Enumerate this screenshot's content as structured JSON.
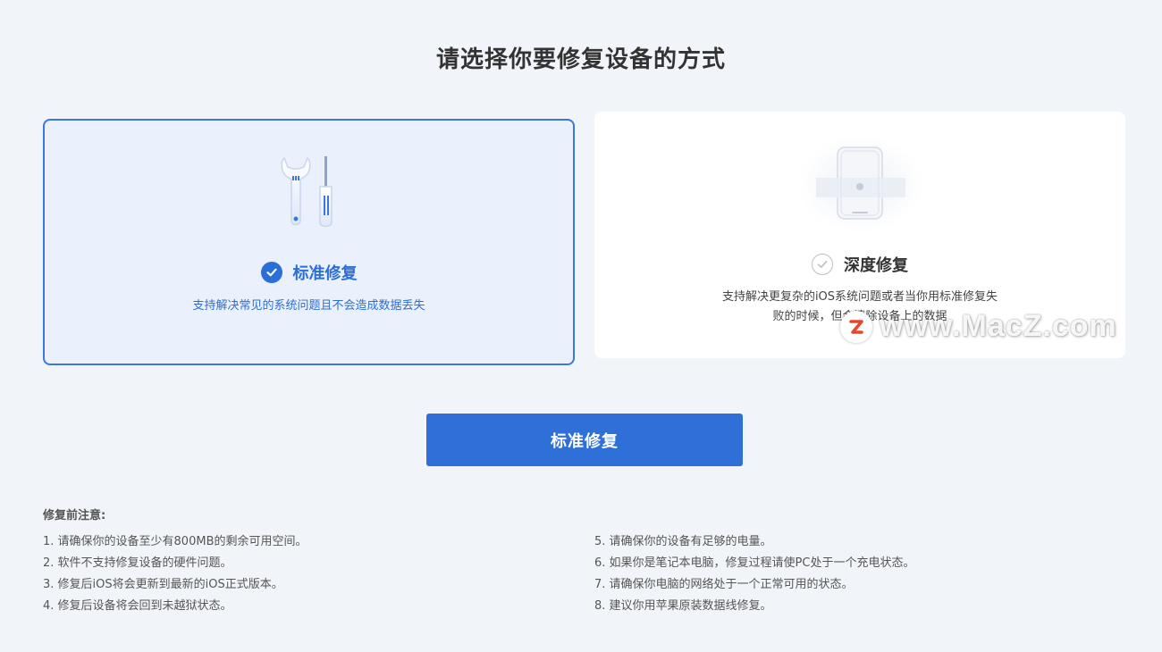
{
  "page": {
    "title": "请选择你要修复设备的方式"
  },
  "cards": {
    "standard": {
      "label": "标准修复",
      "description": "支持解决常见的系统问题且不会造成数据丢失",
      "selected": true,
      "icon": "wrench-screwdriver-icon"
    },
    "deep": {
      "label": "深度修复",
      "description_line1": "支持解决更复杂的iOS系统问题或者当你用标准修复失",
      "description_line2": "败的时候，但会清除设备上的数据",
      "selected": false,
      "icon": "device-repair-icon"
    }
  },
  "primary_button": {
    "label": "标准修复"
  },
  "notes": {
    "title": "修复前注意:",
    "left": [
      "1.  请确保你的设备至少有800MB的剩余可用空间。",
      "2.  软件不支持修复设备的硬件问题。",
      "3.  修复后iOS将会更新到最新的iOS正式版本。",
      "4.  修复后设备将会回到未越狱状态。"
    ],
    "right": [
      "5.  请确保你的设备有足够的电量。",
      "6.  如果你是笔记本电脑，修复过程请使PC处于一个充电状态。",
      "7.  请确保你电脑的网络处于一个正常可用的状态。",
      "8.  建议你用苹果原装数据线修复。"
    ]
  },
  "watermark": {
    "text": "www.MacZ.com",
    "badge": "Z"
  },
  "colors": {
    "accent": "#2f6fd8",
    "selected_bg": "#eaf1fc",
    "background": "#f1f4f9"
  }
}
